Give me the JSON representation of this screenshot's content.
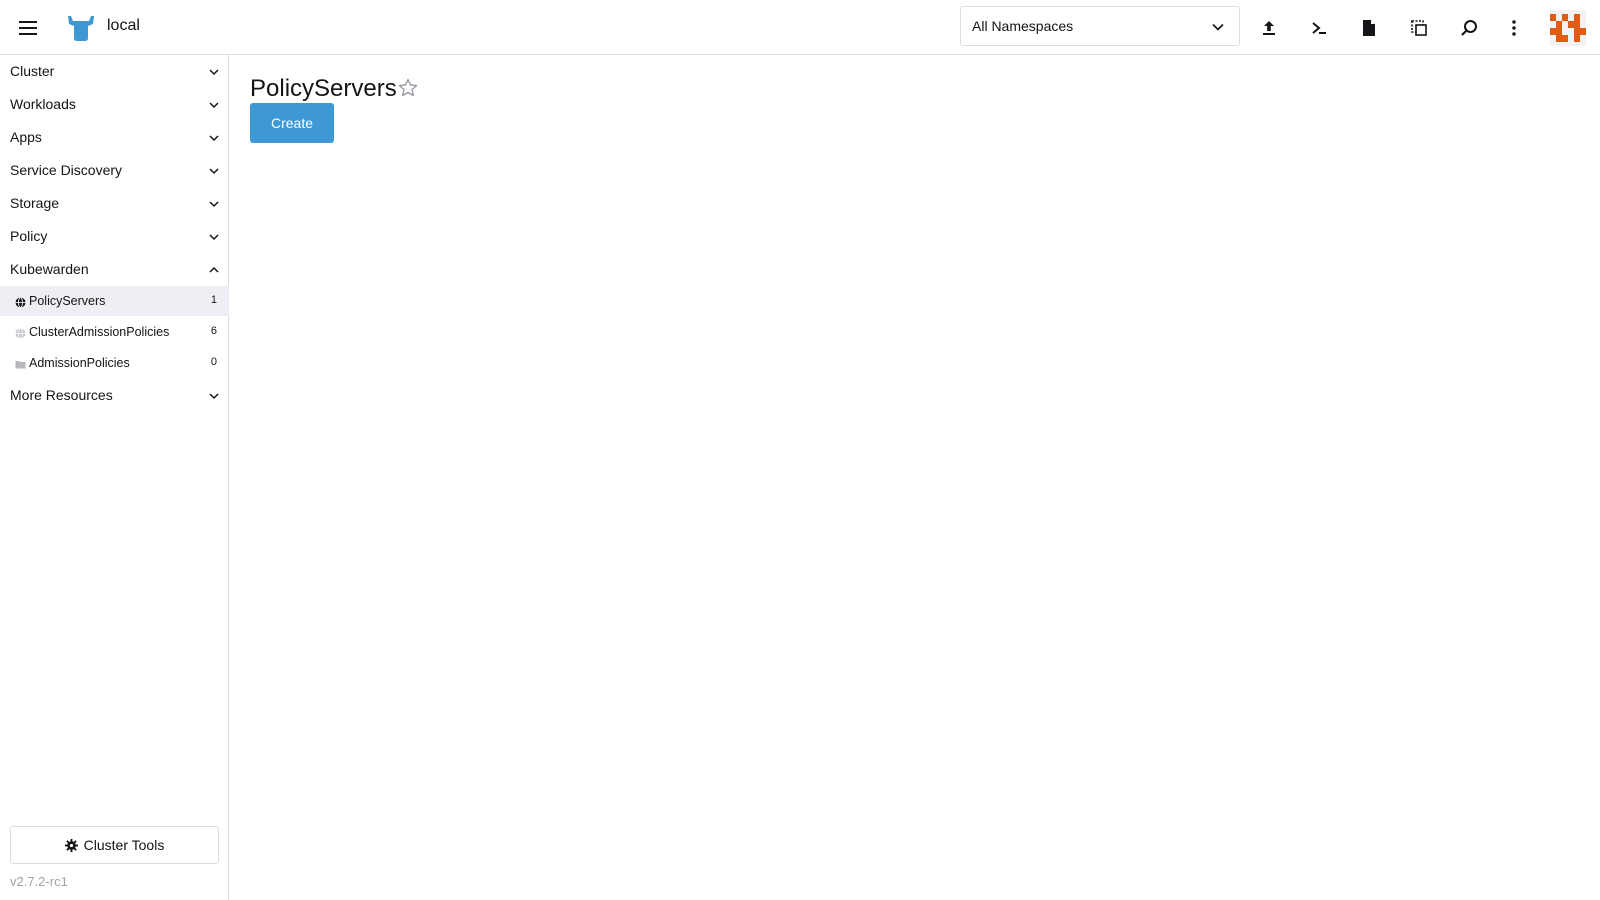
{
  "header": {
    "cluster_name": "local",
    "namespace_select": {
      "value": "All Namespaces"
    },
    "actions": [
      "import-yaml",
      "kubectl-shell",
      "kubeconfig-file",
      "copy-kubeconfig",
      "resource-search",
      "more-actions"
    ]
  },
  "sidebar": {
    "groups": [
      {
        "label": "Cluster",
        "expanded": false
      },
      {
        "label": "Workloads",
        "expanded": false
      },
      {
        "label": "Apps",
        "expanded": false
      },
      {
        "label": "Service Discovery",
        "expanded": false
      },
      {
        "label": "Storage",
        "expanded": false
      },
      {
        "label": "Policy",
        "expanded": false
      },
      {
        "label": "Kubewarden",
        "expanded": true
      },
      {
        "label": "More Resources",
        "expanded": false
      }
    ],
    "kubewarden_items": [
      {
        "label": "PolicyServers",
        "count": "1",
        "icon": "globe-icon",
        "active": true
      },
      {
        "label": "ClusterAdmissionPolicies",
        "count": "6",
        "icon": "globe-icon",
        "active": false
      },
      {
        "label": "AdmissionPolicies",
        "count": "0",
        "icon": "folder-icon",
        "active": false
      }
    ],
    "cluster_tools_label": "Cluster Tools",
    "version": "v2.7.2-rc1"
  },
  "main": {
    "title": "PolicyServers",
    "create_label": "Create"
  },
  "colors": {
    "accent": "#3d98d3",
    "logo": "#3d98d3",
    "avatar": "#e05b14",
    "active_row": "#eeeff4"
  }
}
